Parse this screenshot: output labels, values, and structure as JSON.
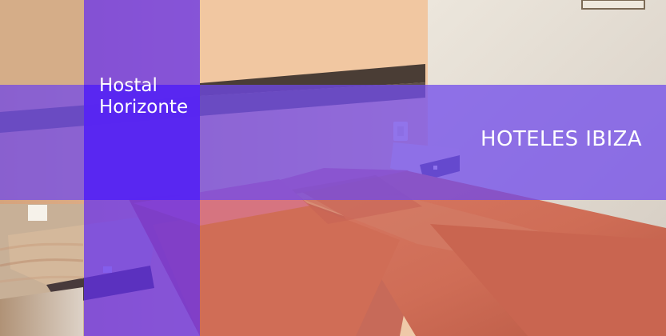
{
  "hotel": {
    "name": "Hostal\nHorizonte",
    "category": "HOTELES IBIZA"
  },
  "theme": {
    "accent_purple": "#6f49ec",
    "text": "#ffffff"
  }
}
